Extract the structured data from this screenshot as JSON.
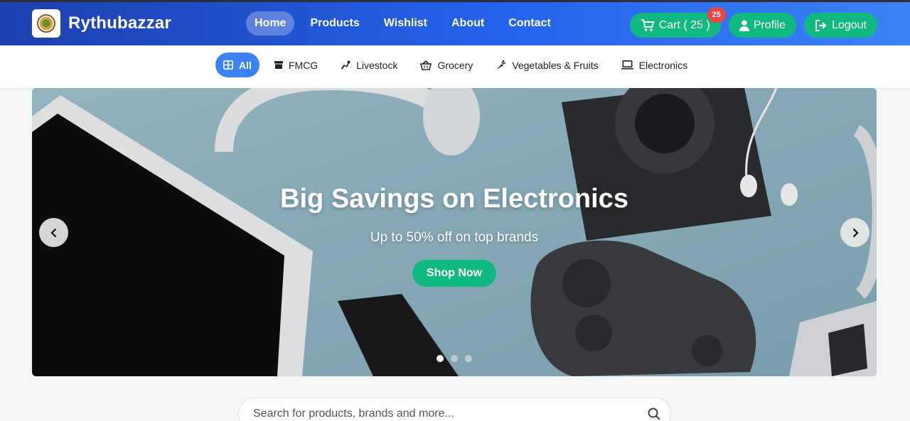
{
  "brand": {
    "name": "Rythubazzar",
    "logo_text": "RAITHU"
  },
  "nav": {
    "items": [
      {
        "label": "Home",
        "active": true
      },
      {
        "label": "Products",
        "active": false
      },
      {
        "label": "Wishlist",
        "active": false
      },
      {
        "label": "About",
        "active": false
      },
      {
        "label": "Contact",
        "active": false
      }
    ]
  },
  "actions": {
    "cart_label": "Cart ( 25 )",
    "cart_badge": "25",
    "profile_label": "Profile",
    "logout_label": "Logout"
  },
  "categories": [
    {
      "label": "All",
      "icon": "grid-icon",
      "active": true
    },
    {
      "label": "FMCG",
      "icon": "box-icon",
      "active": false
    },
    {
      "label": "Livestock",
      "icon": "livestock-icon",
      "active": false
    },
    {
      "label": "Grocery",
      "icon": "basket-icon",
      "active": false
    },
    {
      "label": "Vegetables & Fruits",
      "icon": "carrot-icon",
      "active": false
    },
    {
      "label": "Electronics",
      "icon": "laptop-icon",
      "active": false
    }
  ],
  "hero": {
    "title": "Big Savings on Electronics",
    "subtitle": "Up to 50% off on top brands",
    "cta": "Shop Now",
    "slides": 3,
    "current_slide": 1
  },
  "search": {
    "placeholder": "Search for products, brands and more..."
  },
  "colors": {
    "accent": "#10b981",
    "primary": "#2563eb",
    "badge": "#ef4444",
    "category_active": "#3b82f6"
  }
}
